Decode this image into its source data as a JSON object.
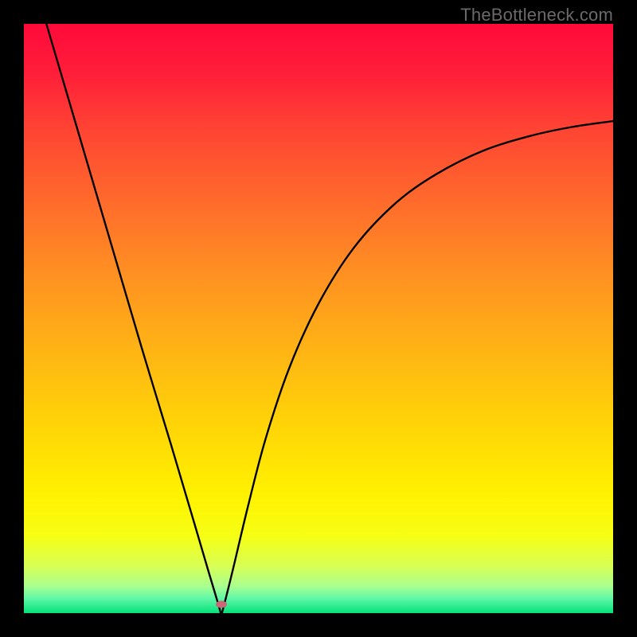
{
  "watermark": "TheBottleneck.com",
  "gradient": {
    "stops": [
      {
        "offset": 0.0,
        "color": "#ff0a3a"
      },
      {
        "offset": 0.08,
        "color": "#ff1d3a"
      },
      {
        "offset": 0.18,
        "color": "#ff4433"
      },
      {
        "offset": 0.3,
        "color": "#ff6a2c"
      },
      {
        "offset": 0.42,
        "color": "#ff8f22"
      },
      {
        "offset": 0.55,
        "color": "#ffb315"
      },
      {
        "offset": 0.68,
        "color": "#ffd407"
      },
      {
        "offset": 0.8,
        "color": "#fff200"
      },
      {
        "offset": 0.87,
        "color": "#f6ff15"
      },
      {
        "offset": 0.92,
        "color": "#d8ff55"
      },
      {
        "offset": 0.955,
        "color": "#a8ff90"
      },
      {
        "offset": 0.975,
        "color": "#60f7a8"
      },
      {
        "offset": 1.0,
        "color": "#05e27b"
      }
    ]
  },
  "marker": {
    "x_frac": 0.335,
    "y_frac": 0.985
  },
  "chart_data": {
    "type": "line",
    "title": "",
    "xlabel": "",
    "ylabel": "",
    "xlim": [
      0,
      1
    ],
    "ylim": [
      0,
      1
    ],
    "note": "Bottleneck curve. x is component performance ratio (normalized 0–1), y is bottleneck percentage (0 = no bottleneck / green, 1 = severe / red). Minimum near x≈0.335.",
    "series": [
      {
        "name": "bottleneck-curve",
        "x": [
          0.0,
          0.05,
          0.1,
          0.15,
          0.2,
          0.25,
          0.29,
          0.315,
          0.33,
          0.335,
          0.34,
          0.355,
          0.38,
          0.41,
          0.45,
          0.5,
          0.56,
          0.63,
          0.7,
          0.78,
          0.86,
          0.93,
          1.0
        ],
        "y": [
          1.13,
          0.96,
          0.79,
          0.62,
          0.45,
          0.285,
          0.15,
          0.065,
          0.015,
          0.0,
          0.015,
          0.075,
          0.18,
          0.295,
          0.415,
          0.525,
          0.62,
          0.695,
          0.745,
          0.785,
          0.81,
          0.825,
          0.835
        ]
      }
    ]
  }
}
